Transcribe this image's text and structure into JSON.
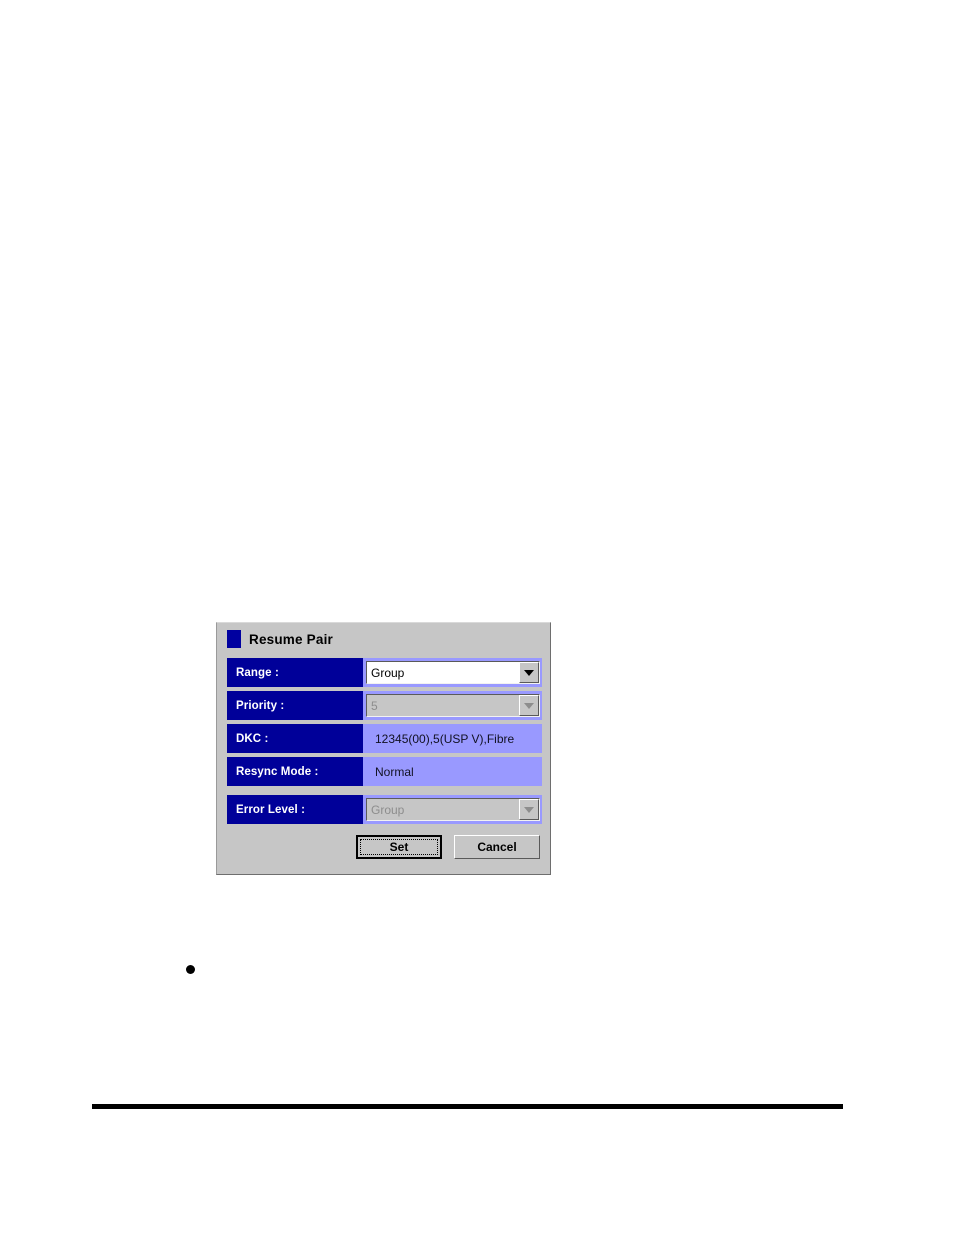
{
  "dialog": {
    "title": "Resume Pair",
    "title_icon": "blue-square-icon",
    "rows": [
      {
        "label": "Range :",
        "value": "Group",
        "control": "combobox",
        "enabled": true
      },
      {
        "label": "Priority :",
        "value": "5",
        "control": "combobox",
        "enabled": false
      },
      {
        "label": "DKC :",
        "value": "12345(00),5(USP V),Fibre",
        "control": "readonly-text",
        "enabled": false
      },
      {
        "label": "Resync Mode :",
        "value": "Normal",
        "control": "readonly-text",
        "enabled": false
      },
      {
        "label": "Error Level :",
        "value": "Group",
        "control": "combobox",
        "enabled": false
      }
    ],
    "buttons": {
      "set_label": "Set",
      "cancel_label": "Cancel"
    },
    "colors": {
      "label_bg": "#000099",
      "value_bg": "#9999FF",
      "panel_bg": "#C6C6C6",
      "disabled_text": "#8D8D8D",
      "title_icon": "#0000A0"
    }
  }
}
